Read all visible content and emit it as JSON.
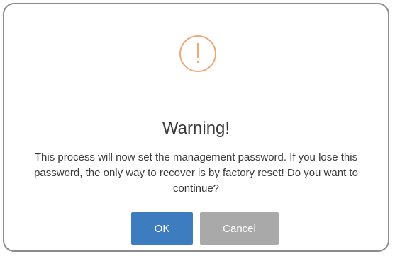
{
  "dialog": {
    "icon": "exclamation-circle-icon",
    "icon_color": "#f0a878",
    "title": "Warning!",
    "message": "This process will now set the management password. If you lose this password, the only way to recover is by factory reset! Do you want to continue?",
    "ok_label": "OK",
    "cancel_label": "Cancel",
    "ok_color": "#3e7cc0",
    "cancel_color": "#a9a9a9"
  }
}
